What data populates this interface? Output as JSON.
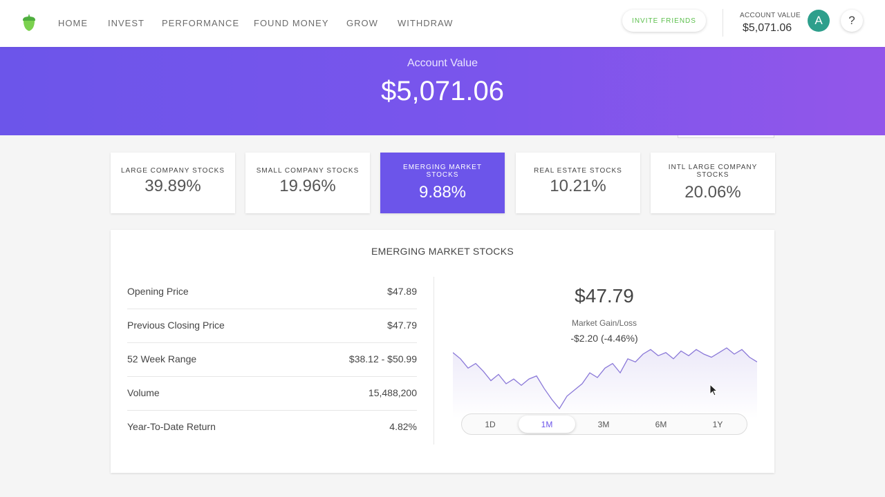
{
  "nav": {
    "items": [
      "HOME",
      "INVEST",
      "PERFORMANCE",
      "FOUND MONEY",
      "GROW",
      "WITHDRAW"
    ],
    "invite_label": "INVITE FRIENDS",
    "account_label": "ACCOUNT VALUE",
    "account_value": "$5,071.06",
    "avatar_initial": "A",
    "help_label": "?"
  },
  "hero": {
    "label": "Account Value",
    "value": "$5,071.06"
  },
  "funds": [
    {
      "label": "LARGE COMPANY STOCKS",
      "value": "39.89%"
    },
    {
      "label": "SMALL COMPANY STOCKS",
      "value": "19.96%"
    },
    {
      "label": "EMERGING MARKET STOCKS",
      "value": "9.88%",
      "active": true
    },
    {
      "label": "REAL ESTATE STOCKS",
      "value": "10.21%"
    },
    {
      "label": "INTL LARGE COMPANY STOCKS",
      "value": "20.06%"
    }
  ],
  "detail": {
    "title": "EMERGING MARKET STOCKS",
    "rows": [
      {
        "label": "Opening Price",
        "value": "$47.89"
      },
      {
        "label": "Previous Closing Price",
        "value": "$47.79"
      },
      {
        "label": "52 Week Range",
        "value": "$38.12 - $50.99"
      },
      {
        "label": "Volume",
        "value": "15,488,200"
      },
      {
        "label": "Year-To-Date Return",
        "value": "4.82%"
      }
    ],
    "price": "$47.79",
    "gain_loss_label": "Market Gain/Loss",
    "gain_loss_value": "-$2.20 (-4.46%)",
    "ranges": [
      "1D",
      "1M",
      "3M",
      "6M",
      "1Y"
    ],
    "active_range": "1M",
    "line_color": "#8a78d8"
  },
  "chart_data": {
    "type": "line",
    "values": [
      49.6,
      49.2,
      48.6,
      48.9,
      48.4,
      47.8,
      48.2,
      47.6,
      47.9,
      47.5,
      47.9,
      48.1,
      47.3,
      46.6,
      46.0,
      46.8,
      47.2,
      47.6,
      48.3,
      48.0,
      48.6,
      48.9,
      48.3,
      49.2,
      49.0,
      49.5,
      49.8,
      49.4,
      49.6,
      49.2,
      49.7,
      49.4,
      49.8,
      49.5,
      49.3,
      49.6,
      49.9,
      49.5,
      49.8,
      49.3,
      49.0
    ]
  }
}
